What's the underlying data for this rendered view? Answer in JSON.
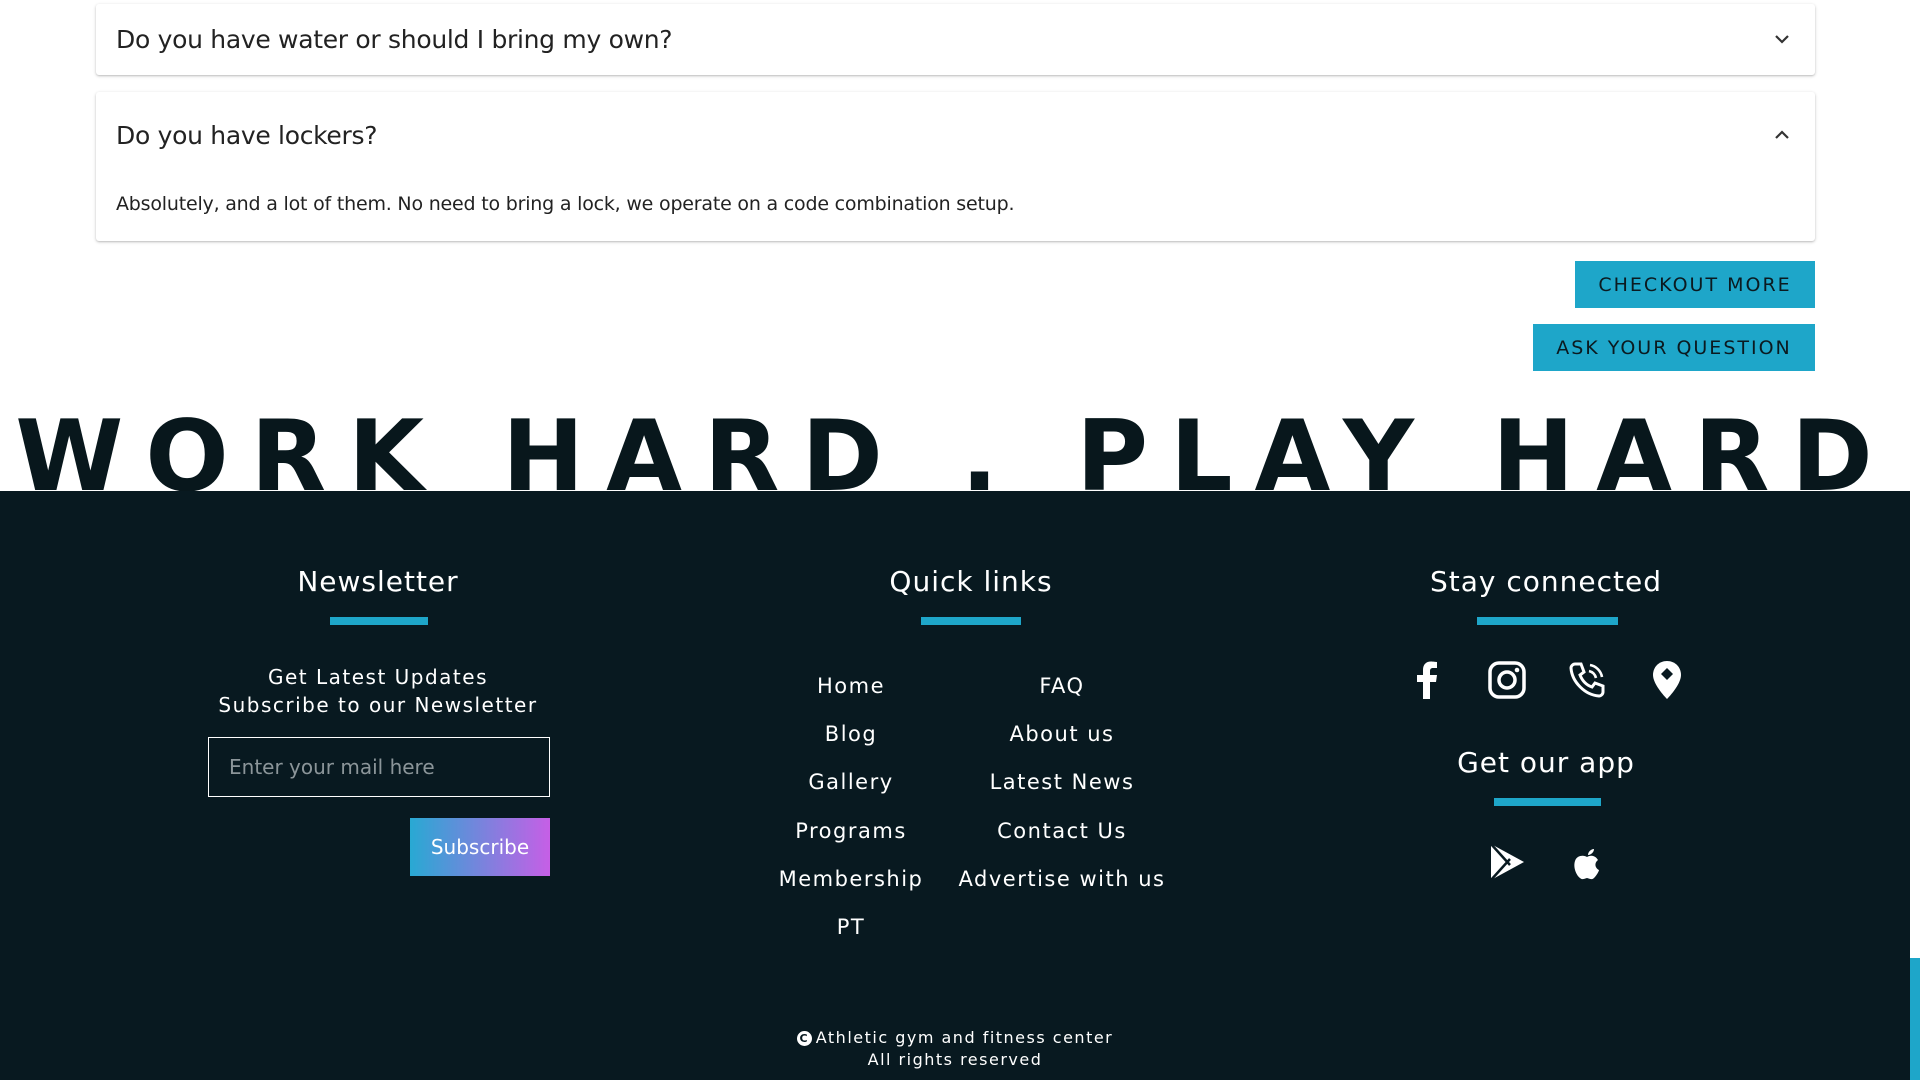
{
  "faq": {
    "items": [
      {
        "question": "Do you have water or should I bring my own?",
        "expanded": false,
        "answer": ""
      },
      {
        "question": "Do you have lockers?",
        "expanded": true,
        "answer": "Absolutely, and a lot of them. No need to bring a lock, we operate on a code combination setup."
      }
    ],
    "checkout_label": "CHECKOUT MORE",
    "ask_label": "ASK YOUR QUESTION"
  },
  "slogan": "WORK HARD . PLAY HARD",
  "footer": {
    "newsletter": {
      "title": "Newsletter",
      "line1": "Get Latest Updates",
      "line2": "Subscribe to our Newsletter",
      "placeholder": "Enter your mail here",
      "subscribe_label": "Subscribe"
    },
    "quick_links": {
      "title": "Quick links",
      "left": [
        "Home",
        "Blog",
        "Gallery",
        "Programs",
        "Membership",
        "PT"
      ],
      "right": [
        "FAQ",
        "About us",
        "Latest News",
        "Contact Us",
        "Advertise with us"
      ]
    },
    "stay_connected": {
      "title": "Stay connected",
      "icons": [
        "facebook-icon",
        "instagram-icon",
        "phone-icon",
        "location-pin-icon"
      ]
    },
    "app": {
      "title": "Get our app",
      "icons": [
        "google-play-icon",
        "apple-icon"
      ]
    },
    "copyright": {
      "line1": "Athletic gym and fitness center",
      "line2": "All rights reserved"
    }
  },
  "colors": {
    "accent": "#1ea6c9",
    "footer_bg": "#081920",
    "gradient_start": "#28a9d3",
    "gradient_end": "#c65fe6"
  }
}
